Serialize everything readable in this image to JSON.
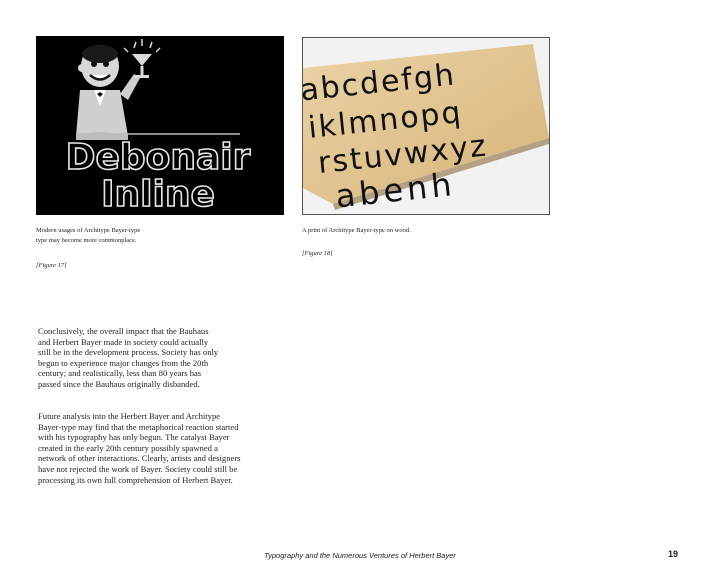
{
  "figures": {
    "fig17": {
      "logo_line1": "Debonair",
      "logo_line2": "Inline",
      "caption_lines": [
        "Modern usages of Architype Bayer-type",
        "type may become more commonplace."
      ],
      "ref": "[Figure 17]"
    },
    "fig18": {
      "letters_row1": "abcdefgh",
      "letters_row2": "iklmnopq",
      "letters_row3": "rstuvwxyz",
      "letters_row4": "abenh",
      "caption_lines": [
        "A print of Architype Bayer-type on wood."
      ],
      "ref": "[Figure 18]"
    }
  },
  "body": {
    "para1": [
      "Conclusively, the overall impact that the Bauhaus",
      "and Herbert Bayer made in society could actually",
      "still be in the development process. Society has only",
      "begun to experience major changes from the 20th",
      "century; and realistically, less than 80 years has",
      "passed since the Bauhaus originally disbanded."
    ],
    "para2": [
      "Future analysis into the Herbert Bayer and Architype",
      "Bayer-type may find that the metaphorical reaction started",
      "with his typography has only begun. The catalyst Bayer",
      "created in the early 20th century possibly spawned a",
      "network of other interactions. Clearly, artists and designers",
      "have not rejected the work of Bayer. Society could still be",
      "processing its own full comprehension of Herbert Bayer."
    ]
  },
  "footer": {
    "title": "Typography and the Numerous Ventures of Herbert Bayer",
    "page_number": "19"
  }
}
